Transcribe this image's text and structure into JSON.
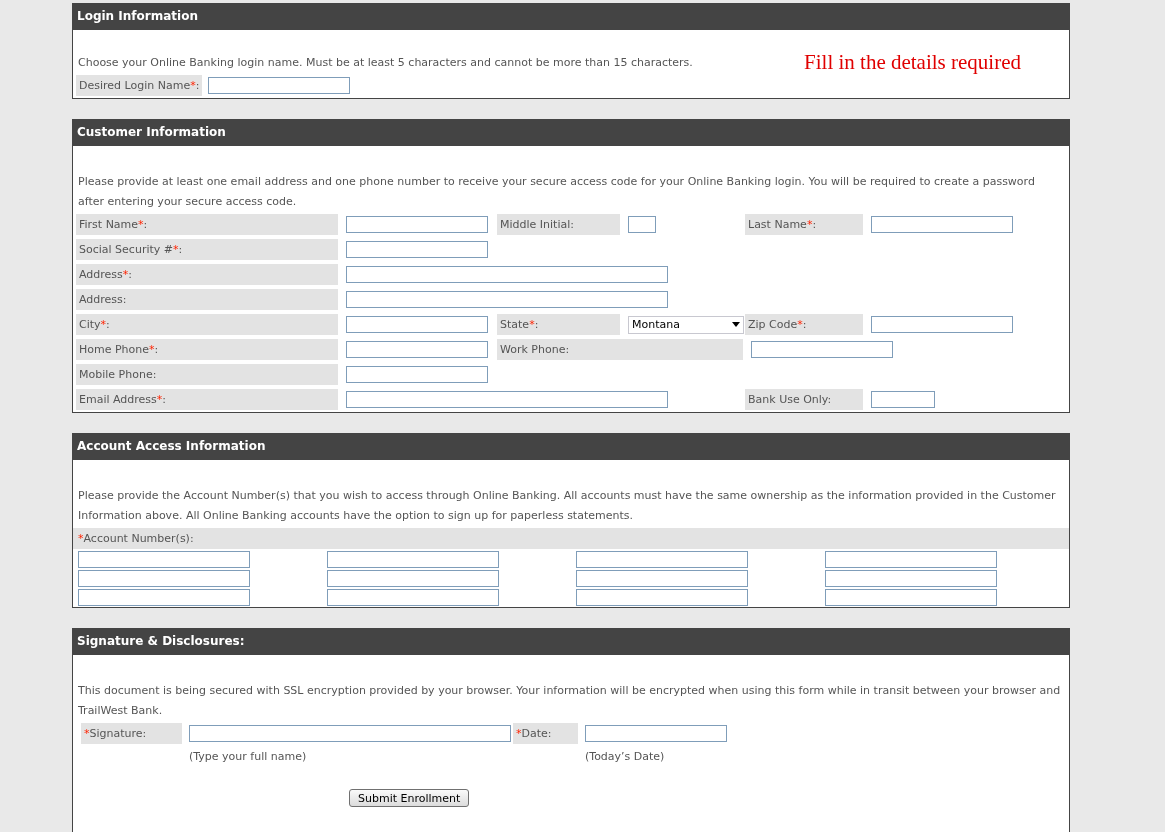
{
  "login": {
    "title": "Login Information",
    "intro": "Choose your Online Banking login name. Must be at least 5 characters and cannot be more than 15 characters.",
    "notice": "Fill in the details required",
    "field": {
      "label": [
        {
          "text": "Desired Login Name",
          "kind": "plain"
        },
        {
          "text": "*",
          "kind": "mark"
        },
        {
          "text": ":",
          "kind": "plain"
        }
      ]
    }
  },
  "customer": {
    "title": "Customer Information",
    "intro": "Please provide at least one email address and one phone number to receive your secure access code for your Online Banking login. You will be required to create a password after entering your secure access code.",
    "rows": [
      [
        {
          "kind": "label",
          "label": [
            {
              "text": "First Name",
              "kind": "plain"
            },
            {
              "text": "*",
              "kind": "mark"
            },
            {
              "text": ":",
              "kind": "plain"
            }
          ]
        },
        {
          "kind": "input"
        },
        {
          "kind": "label",
          "label": [
            {
              "text": "Middle Initial:",
              "kind": "plain"
            }
          ]
        },
        {
          "kind": "tiny-input"
        },
        {
          "kind": "label",
          "label": [
            {
              "text": "Last Name",
              "kind": "plain"
            },
            {
              "text": "*",
              "kind": "mark"
            },
            {
              "text": ":",
              "kind": "plain"
            }
          ]
        },
        {
          "kind": "input"
        }
      ],
      [
        {
          "kind": "label",
          "label": [
            {
              "text": "Social Security #",
              "kind": "plain"
            },
            {
              "text": "*",
              "kind": "mark"
            },
            {
              "text": ":",
              "kind": "plain"
            }
          ]
        },
        {
          "kind": "input"
        }
      ],
      [
        {
          "kind": "label",
          "label": [
            {
              "text": "Address",
              "kind": "plain"
            },
            {
              "text": "*",
              "kind": "mark"
            },
            {
              "text": ":",
              "kind": "plain"
            }
          ]
        },
        {
          "kind": "wide-input"
        }
      ],
      [
        {
          "kind": "label",
          "label": [
            {
              "text": "Address:",
              "kind": "plain"
            }
          ]
        },
        {
          "kind": "wide-input"
        }
      ],
      [
        {
          "kind": "label",
          "label": [
            {
              "text": "City",
              "kind": "plain"
            },
            {
              "text": "*",
              "kind": "mark"
            },
            {
              "text": ":",
              "kind": "plain"
            }
          ]
        },
        {
          "kind": "input"
        },
        {
          "kind": "label",
          "label": [
            {
              "text": "State",
              "kind": "plain"
            },
            {
              "text": "*",
              "kind": "mark"
            },
            {
              "text": ":",
              "kind": "plain"
            }
          ]
        },
        {
          "kind": "select",
          "value": "Montana"
        },
        {
          "kind": "label",
          "label": [
            {
              "text": "Zip Code",
              "kind": "plain"
            },
            {
              "text": "*",
              "kind": "mark"
            },
            {
              "text": ":",
              "kind": "plain"
            }
          ]
        },
        {
          "kind": "input"
        }
      ],
      [
        {
          "kind": "label",
          "label": [
            {
              "text": "Home Phone",
              "kind": "plain"
            },
            {
              "text": "*",
              "kind": "mark"
            },
            {
              "text": ":",
              "kind": "plain"
            }
          ]
        },
        {
          "kind": "input"
        },
        {
          "kind": "wide-label",
          "label": [
            {
              "text": "Work Phone:",
              "kind": "plain"
            }
          ]
        },
        "",
        {
          "kind": "input"
        }
      ],
      [
        {
          "kind": "label",
          "label": [
            {
              "text": "Mobile Phone:",
              "kind": "plain"
            }
          ]
        },
        {
          "kind": "input"
        }
      ],
      [
        {
          "kind": "label",
          "label": [
            {
              "text": "Email Address",
              "kind": "plain"
            },
            {
              "text": "*",
              "kind": "mark"
            },
            {
              "text": ":",
              "kind": "plain"
            }
          ]
        },
        {
          "kind": "wide-input"
        },
        "",
        "",
        {
          "kind": "label",
          "label": [
            {
              "text": "Bank Use Only:",
              "kind": "plain"
            }
          ]
        },
        {
          "kind": "small-input"
        }
      ]
    ]
  },
  "account": {
    "title": "Account Access Information",
    "intro": "Please provide the Account Number(s) that you wish to access through Online Banking. All accounts must have the same ownership as the information provided in the Customer Information above. All Online Banking accounts have the option to sign up for paperless statements.",
    "label": [
      {
        "text": "*",
        "kind": "mark"
      },
      {
        "text": "Account Number(s):",
        "kind": "plain"
      }
    ],
    "fields": [
      {
        "kind": "input"
      },
      {
        "kind": "input"
      },
      {
        "kind": "input"
      },
      {
        "kind": "input"
      },
      {
        "kind": "input"
      },
      {
        "kind": "input"
      },
      {
        "kind": "input"
      },
      {
        "kind": "input"
      },
      {
        "kind": "input"
      },
      {
        "kind": "input"
      },
      {
        "kind": "input"
      },
      {
        "kind": "input"
      }
    ]
  },
  "signature": {
    "title": "Signature & Disclosures:",
    "intro": "This document is being secured with SSL encryption provided by your browser. Your information will be encrypted when using this form while in transit between your browser and TrailWest Bank.",
    "name_label": [
      {
        "text": "*",
        "kind": "mark"
      },
      {
        "text": "Signature:",
        "kind": "plain"
      }
    ],
    "name_hint": "(Type your full name)",
    "date_label": [
      {
        "text": "*",
        "kind": "mark"
      },
      {
        "text": "Date:",
        "kind": "plain"
      }
    ],
    "date_hint": "(Today’s Date)",
    "submit": "Submit Enrollment"
  }
}
